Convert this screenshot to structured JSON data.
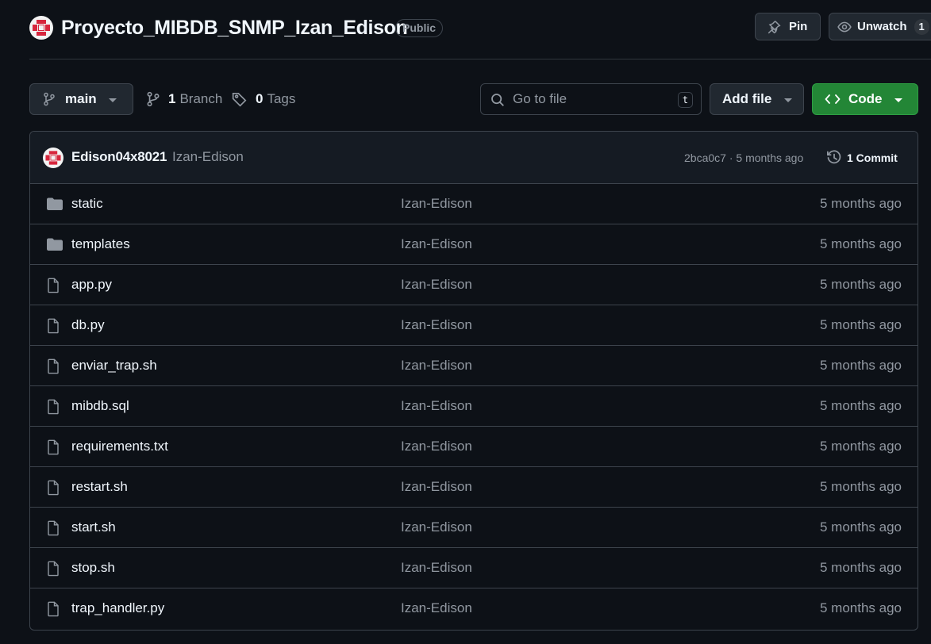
{
  "repo": {
    "name": "Proyecto_MIBDB_SNMP_Izan_Edison",
    "visibility": "Public",
    "avatar_icon": "identicon-avatar"
  },
  "header_actions": {
    "pin_label": "Pin",
    "watch_label": "Unwatch",
    "watch_count": "1"
  },
  "toolbar": {
    "branch_name": "main",
    "branch_count": "1",
    "branch_label": "Branch",
    "tag_count": "0",
    "tag_label": "Tags",
    "search_placeholder": "Go to file",
    "search_shortcut": "t",
    "add_file_label": "Add file",
    "code_label": "Code"
  },
  "latest_commit": {
    "author": "Edison04x8021",
    "message": "Izan-Edison",
    "hash": "2bca0c7",
    "separator": " · ",
    "time": "5 months ago",
    "commit_count_label": "1 Commit"
  },
  "files": [
    {
      "type": "folder",
      "name": "static",
      "commit": "Izan-Edison",
      "date": "5 months ago"
    },
    {
      "type": "folder",
      "name": "templates",
      "commit": "Izan-Edison",
      "date": "5 months ago"
    },
    {
      "type": "file",
      "name": "app.py",
      "commit": "Izan-Edison",
      "date": "5 months ago"
    },
    {
      "type": "file",
      "name": "db.py",
      "commit": "Izan-Edison",
      "date": "5 months ago"
    },
    {
      "type": "file",
      "name": "enviar_trap.sh",
      "commit": "Izan-Edison",
      "date": "5 months ago"
    },
    {
      "type": "file",
      "name": "mibdb.sql",
      "commit": "Izan-Edison",
      "date": "5 months ago"
    },
    {
      "type": "file",
      "name": "requirements.txt",
      "commit": "Izan-Edison",
      "date": "5 months ago"
    },
    {
      "type": "file",
      "name": "restart.sh",
      "commit": "Izan-Edison",
      "date": "5 months ago"
    },
    {
      "type": "file",
      "name": "start.sh",
      "commit": "Izan-Edison",
      "date": "5 months ago"
    },
    {
      "type": "file",
      "name": "stop.sh",
      "commit": "Izan-Edison",
      "date": "5 months ago"
    },
    {
      "type": "file",
      "name": "trap_handler.py",
      "commit": "Izan-Edison",
      "date": "5 months ago"
    }
  ],
  "colors": {
    "background": "#0d1117",
    "border": "#3d444d",
    "text": "#f0f6fc",
    "muted": "#9198a1",
    "code_button": "#238636",
    "avatar_red": "#d7263d"
  }
}
